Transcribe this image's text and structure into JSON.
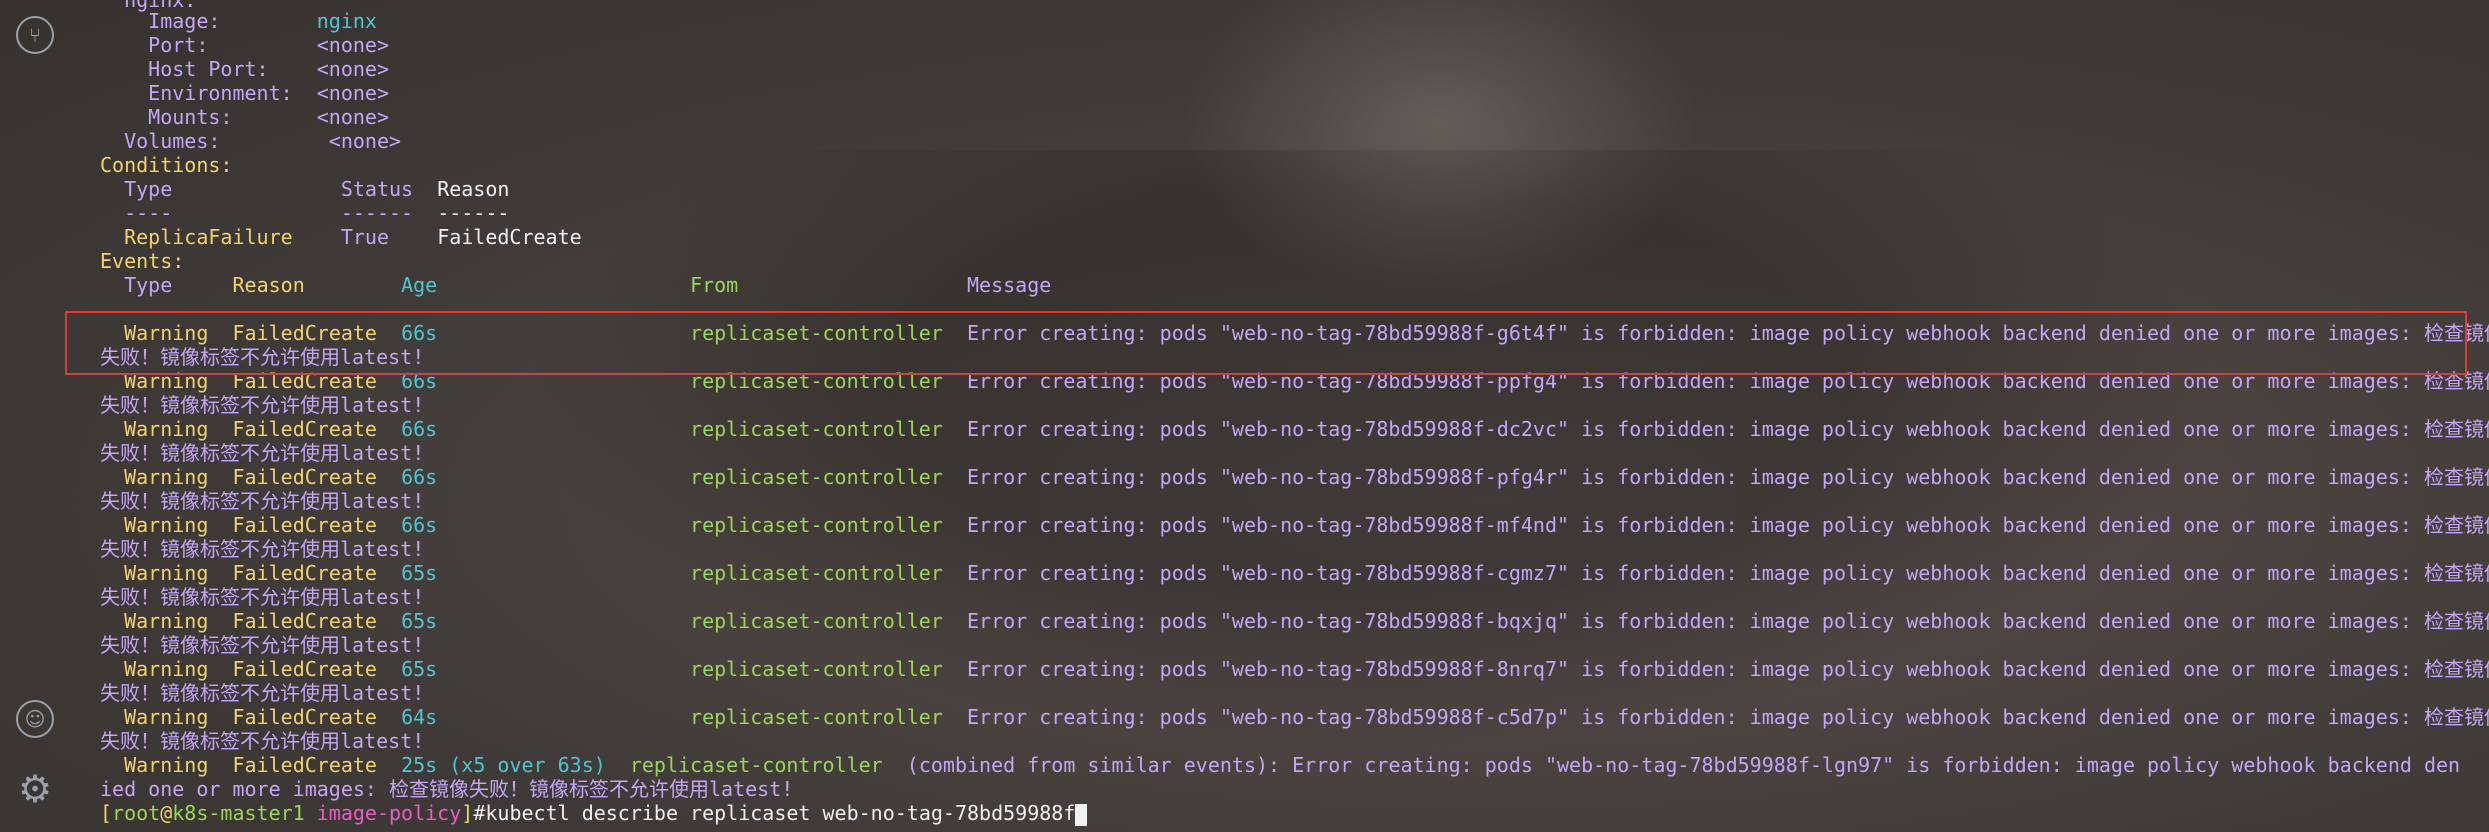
{
  "sidebar": {
    "top_icon": "git-branch-icon",
    "user_icon": "user-icon",
    "settings_icon": "gear-icon"
  },
  "terminal": {
    "container": {
      "name_line": "nginx:",
      "image_label": "Image:",
      "image_value": "nginx",
      "port_label": "Port:",
      "port_value": "<none>",
      "host_port_label": "Host Port:",
      "host_port_value": "<none>",
      "env_label": "Environment:",
      "env_value": "<none>",
      "mounts_label": "Mounts:",
      "mounts_value": "<none>",
      "volumes_label": "Volumes:",
      "volumes_value": "<none>"
    },
    "conditions": {
      "heading": "Conditions:",
      "col_type": "Type",
      "col_status": "Status",
      "col_reason": "Reason",
      "sep_type": "----",
      "sep_status": "------",
      "sep_reason": "------",
      "row_type": "ReplicaFailure",
      "row_status": "True",
      "row_reason": "FailedCreate"
    },
    "events": {
      "heading": "Events:",
      "col_type": "Type",
      "col_reason": "Reason",
      "col_age": "Age",
      "col_from": "From",
      "col_message": "Message",
      "rows": [
        {
          "type": "Warning",
          "reason": "FailedCreate",
          "age": "66s",
          "from": "replicaset-controller",
          "message": "Error creating: pods \"web-no-tag-78bd59988f-g6t4f\" is forbidden: image policy webhook backend denied one or more images: 检查镜像",
          "cont": "失败！镜像标签不允许使用latest!"
        },
        {
          "type": "Warning",
          "reason": "FailedCreate",
          "age": "66s",
          "from": "replicaset-controller",
          "message": "Error creating: pods \"web-no-tag-78bd59988f-ppfg4\" is forbidden: image policy webhook backend denied one or more images: 检查镜像",
          "cont": "失败！镜像标签不允许使用latest!"
        },
        {
          "type": "Warning",
          "reason": "FailedCreate",
          "age": "66s",
          "from": "replicaset-controller",
          "message": "Error creating: pods \"web-no-tag-78bd59988f-dc2vc\" is forbidden: image policy webhook backend denied one or more images: 检查镜像",
          "cont": "失败！镜像标签不允许使用latest!"
        },
        {
          "type": "Warning",
          "reason": "FailedCreate",
          "age": "66s",
          "from": "replicaset-controller",
          "message": "Error creating: pods \"web-no-tag-78bd59988f-pfg4r\" is forbidden: image policy webhook backend denied one or more images: 检查镜像",
          "cont": "失败！镜像标签不允许使用latest!"
        },
        {
          "type": "Warning",
          "reason": "FailedCreate",
          "age": "66s",
          "from": "replicaset-controller",
          "message": "Error creating: pods \"web-no-tag-78bd59988f-mf4nd\" is forbidden: image policy webhook backend denied one or more images: 检查镜像",
          "cont": "失败！镜像标签不允许使用latest!"
        },
        {
          "type": "Warning",
          "reason": "FailedCreate",
          "age": "65s",
          "from": "replicaset-controller",
          "message": "Error creating: pods \"web-no-tag-78bd59988f-cgmz7\" is forbidden: image policy webhook backend denied one or more images: 检查镜像",
          "cont": "失败！镜像标签不允许使用latest!"
        },
        {
          "type": "Warning",
          "reason": "FailedCreate",
          "age": "65s",
          "from": "replicaset-controller",
          "message": "Error creating: pods \"web-no-tag-78bd59988f-bqxjq\" is forbidden: image policy webhook backend denied one or more images: 检查镜像",
          "cont": "失败！镜像标签不允许使用latest!"
        },
        {
          "type": "Warning",
          "reason": "FailedCreate",
          "age": "65s",
          "from": "replicaset-controller",
          "message": "Error creating: pods \"web-no-tag-78bd59988f-8nrq7\" is forbidden: image policy webhook backend denied one or more images: 检查镜像",
          "cont": "失败！镜像标签不允许使用latest!"
        },
        {
          "type": "Warning",
          "reason": "FailedCreate",
          "age": "64s",
          "from": "replicaset-controller",
          "message": "Error creating: pods \"web-no-tag-78bd59988f-c5d7p\" is forbidden: image policy webhook backend denied one or more images: 检查镜像",
          "cont": "失败！镜像标签不允许使用latest!"
        },
        {
          "type": "Warning",
          "reason": "FailedCreate",
          "age": "25s (x5 over 63s)",
          "from": "replicaset-controller",
          "message": "(combined from similar events): Error creating: pods \"web-no-tag-78bd59988f-lgn97\" is forbidden: image policy webhook backend den",
          "cont": "ied one or more images: 检查镜像失败！镜像标签不允许使用latest!"
        }
      ]
    },
    "prompt": {
      "open": "[",
      "user": "root",
      "at": "@",
      "host": "k8s-master1",
      "dir": "image-policy",
      "close": "]",
      "hash": "#",
      "command": "kubectl describe replicaset web-no-tag-78bd59988f"
    }
  }
}
